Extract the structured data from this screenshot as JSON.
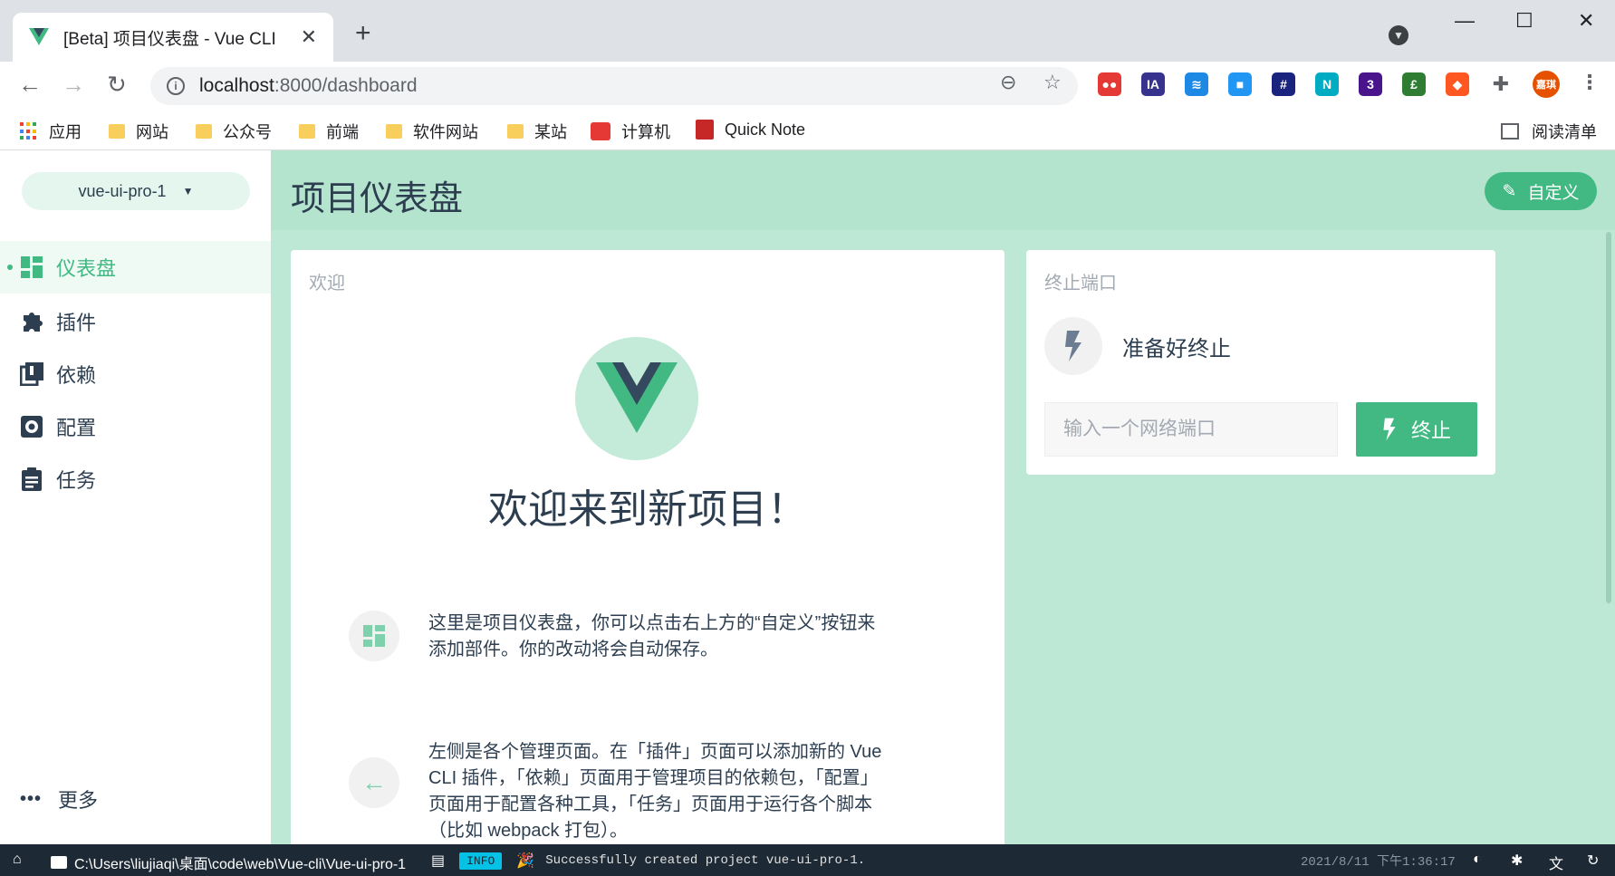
{
  "browser": {
    "tab_title": "[Beta] 项目仪表盘 - Vue CLI",
    "tab_close": "✕",
    "new_tab": "+",
    "url_host": "localhost",
    "url_path": ":8000/dashboard",
    "win_min": "—",
    "win_max": "☐",
    "win_close": "✕",
    "extensions": [
      {
        "name": "red-extension-icon",
        "color": "#e53935",
        "glyph": "●●"
      },
      {
        "name": "ia-extension-icon",
        "color": "#37328d",
        "glyph": "IA"
      },
      {
        "name": "blue-lines-extension-icon",
        "color": "#1e88e5",
        "glyph": "≋"
      },
      {
        "name": "blue-square-extension-icon",
        "color": "#2196f3",
        "glyph": "■"
      },
      {
        "name": "hash-extension-icon",
        "color": "#1a237e",
        "glyph": "#"
      },
      {
        "name": "n-extension-icon",
        "color": "#00acc1",
        "glyph": "N"
      },
      {
        "name": "graduation-extension-icon",
        "color": "#4a148c",
        "glyph": "3"
      },
      {
        "name": "shield-extension-icon",
        "color": "#2e7d32",
        "glyph": "£"
      },
      {
        "name": "orange-extension-icon",
        "color": "#ff5722",
        "glyph": "◆"
      },
      {
        "name": "puzzle-extension-icon",
        "color": "#5f6368",
        "glyph": "✚"
      },
      {
        "name": "profile-avatar-icon",
        "color": "#e65100",
        "glyph": "嘉琪"
      }
    ],
    "bookmarks": [
      {
        "label": "应用",
        "type": "apps"
      },
      {
        "label": "网站",
        "type": "folder"
      },
      {
        "label": "公众号",
        "type": "folder"
      },
      {
        "label": "前端",
        "type": "folder"
      },
      {
        "label": "软件网站",
        "type": "folder"
      },
      {
        "label": "某站",
        "type": "folder"
      },
      {
        "label": "计算机",
        "type": "red"
      },
      {
        "label": "Quick Note",
        "type": "book"
      }
    ],
    "reading_list": "阅读清单"
  },
  "sidebar": {
    "project_name": "vue-ui-pro-1",
    "items": [
      {
        "label": "仪表盘",
        "icon": "dashboard-icon"
      },
      {
        "label": "插件",
        "icon": "puzzle-icon"
      },
      {
        "label": "依赖",
        "icon": "library-icon"
      },
      {
        "label": "配置",
        "icon": "settings-icon"
      },
      {
        "label": "任务",
        "icon": "clipboard-icon"
      }
    ],
    "more": "更多"
  },
  "header": {
    "title": "项目仪表盘",
    "customize": "自定义"
  },
  "welcome": {
    "title": "欢迎",
    "heading": "欢迎来到新项目！",
    "tip1": "这里是项目仪表盘，你可以点击右上方的“自定义”按钮来添加部件。你的改动将会自动保存。",
    "tip2": "左侧是各个管理页面。在「插件」页面可以添加新的 Vue CLI 插件，「依赖」页面用于管理项目的依赖包，「配置」页面用于配置各种工具，「任务」页面用于运行各个脚本（比如 webpack 打包）。"
  },
  "killport": {
    "title": "终止端口",
    "status": "准备好终止",
    "placeholder": "输入一个网络端口",
    "button": "终止"
  },
  "statusbar": {
    "path": "C:\\Users\\liujiaqi\\桌面\\code\\web\\Vue-cli\\Vue-ui-pro-1",
    "level": "INFO",
    "message": "Successfully created project vue-ui-pro-1.",
    "time": "2021/8/11 下午1:36:17"
  }
}
